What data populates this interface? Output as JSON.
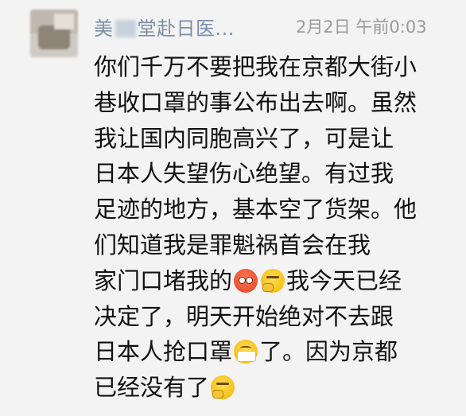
{
  "message": {
    "sender_start": "美",
    "sender_end": "堂赴日医...",
    "timestamp": "2月2日 午前0:03",
    "lines": [
      "你们千万不要把我在京都大街小",
      "巷收口罩的事公布出去啊。虽然",
      "我让国内同胞高兴了，可是让",
      "日本人失望伤心绝望。有过我",
      "足迹的地方，基本空了货架。他",
      "们知道我是罪魁祸首会在我",
      "家门口堵我的",
      "我今天已经",
      "决定了，明天开始绝对不去跟",
      "日本人抢口罩",
      "了。因为京都",
      "已经没有了"
    ],
    "icons": [
      "angry-emoji",
      "thinking-emoji",
      "mask-emoji"
    ]
  }
}
